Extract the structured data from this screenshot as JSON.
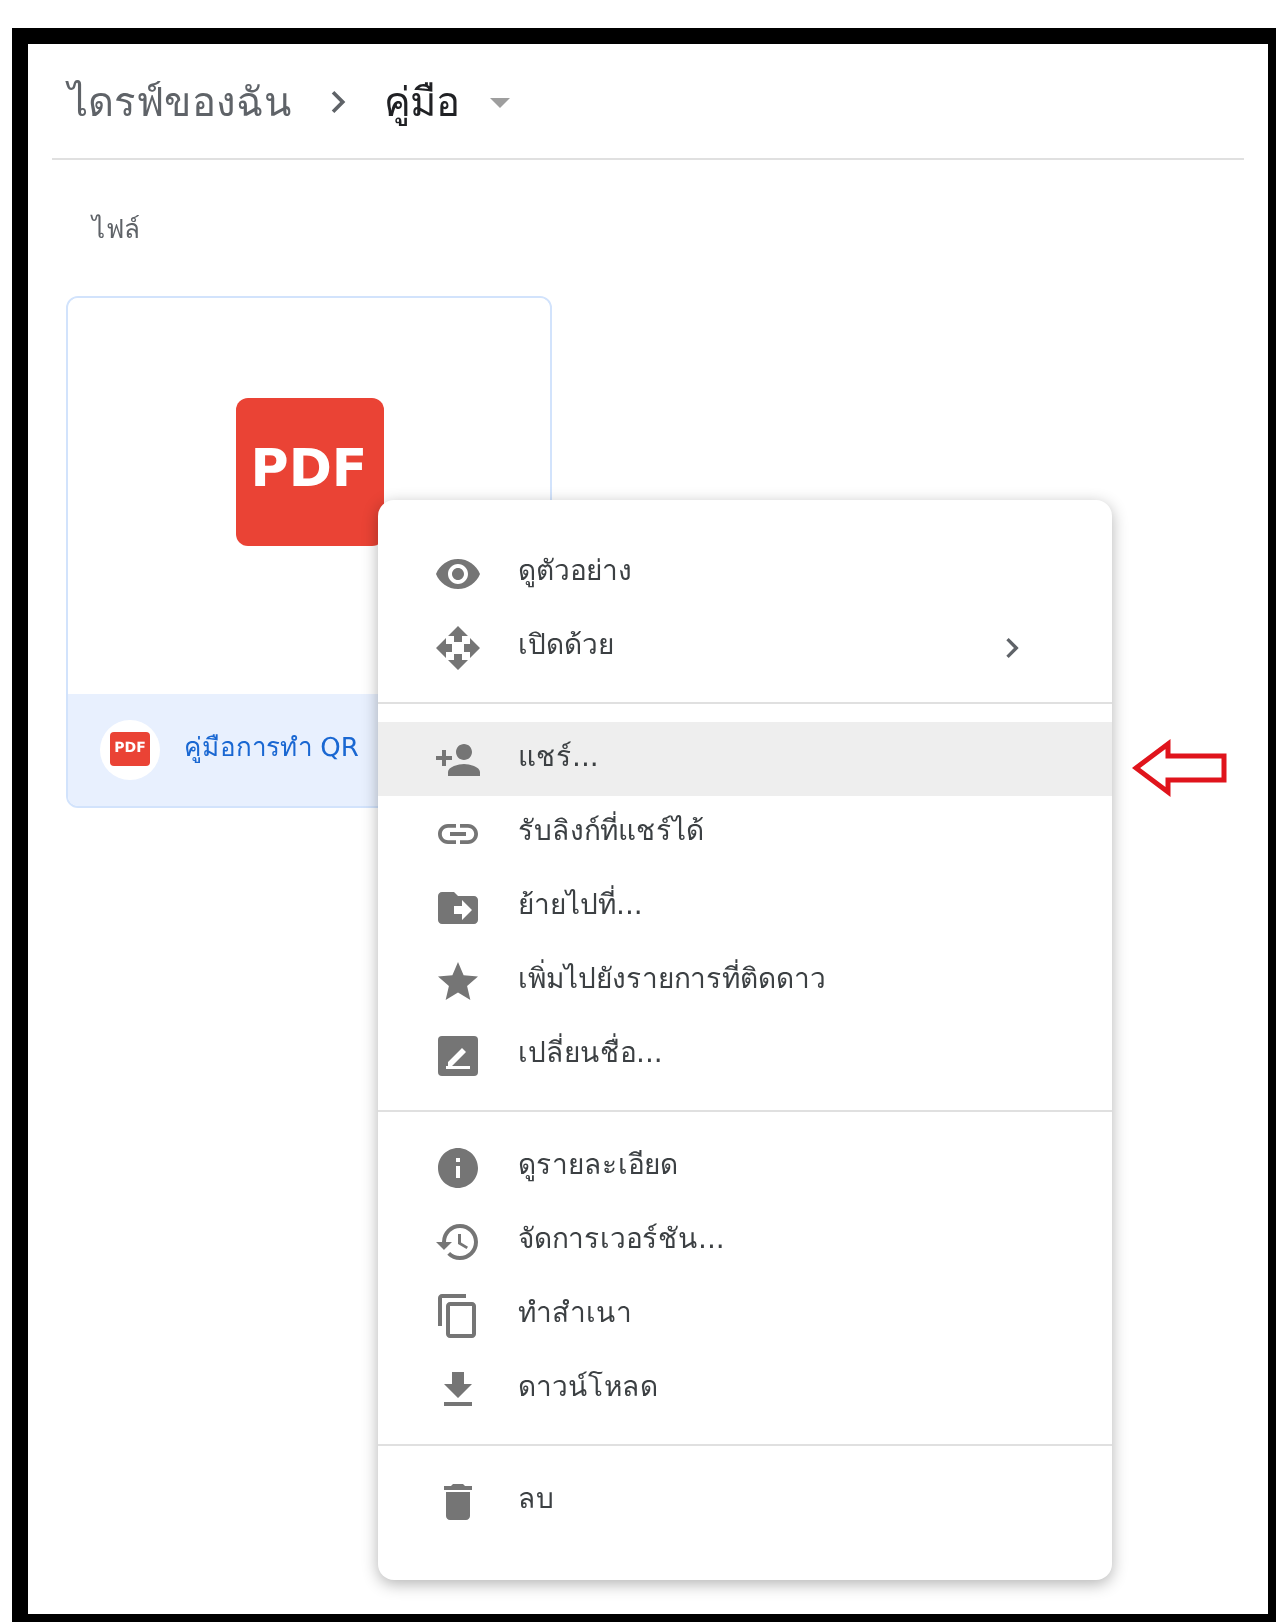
{
  "breadcrumb": [
    {
      "label": "ไดรฟ์ของฉัน",
      "selected": false
    },
    {
      "label": "คู่มือ",
      "selected": true
    }
  ],
  "section_title": "ไฟล์",
  "file_card": {
    "badge": "PDF",
    "small_badge": "PDF",
    "name": "คู่มือการทำ QR",
    "selected": true
  },
  "context_menu": {
    "groups": [
      [
        {
          "label": "ดูตัวอย่าง",
          "submenu": false,
          "selected": false
        },
        {
          "label": "เปิดด้วย",
          "submenu": true,
          "selected": false
        }
      ],
      [
        {
          "label": "แชร์...",
          "submenu": false,
          "selected": true
        },
        {
          "label": "รับลิงก์ที่แชร์ได้",
          "submenu": false,
          "selected": false
        },
        {
          "label": "ย้ายไปที่...",
          "submenu": false,
          "selected": false
        },
        {
          "label": "เพิ่มไปยังรายการที่ติดดาว",
          "submenu": false,
          "selected": false
        },
        {
          "label": "เปลี่ยนชื่อ...",
          "submenu": false,
          "selected": false
        }
      ],
      [
        {
          "label": "ดูรายละเอียด",
          "submenu": false,
          "selected": false
        },
        {
          "label": "จัดการเวอร์ชัน...",
          "submenu": false,
          "selected": false
        },
        {
          "label": "ทำสำเนา",
          "submenu": false,
          "selected": false
        },
        {
          "label": "ดาวน์โหลด",
          "submenu": false,
          "selected": false
        }
      ],
      [
        {
          "label": "ลบ",
          "submenu": false,
          "selected": false
        }
      ]
    ]
  }
}
